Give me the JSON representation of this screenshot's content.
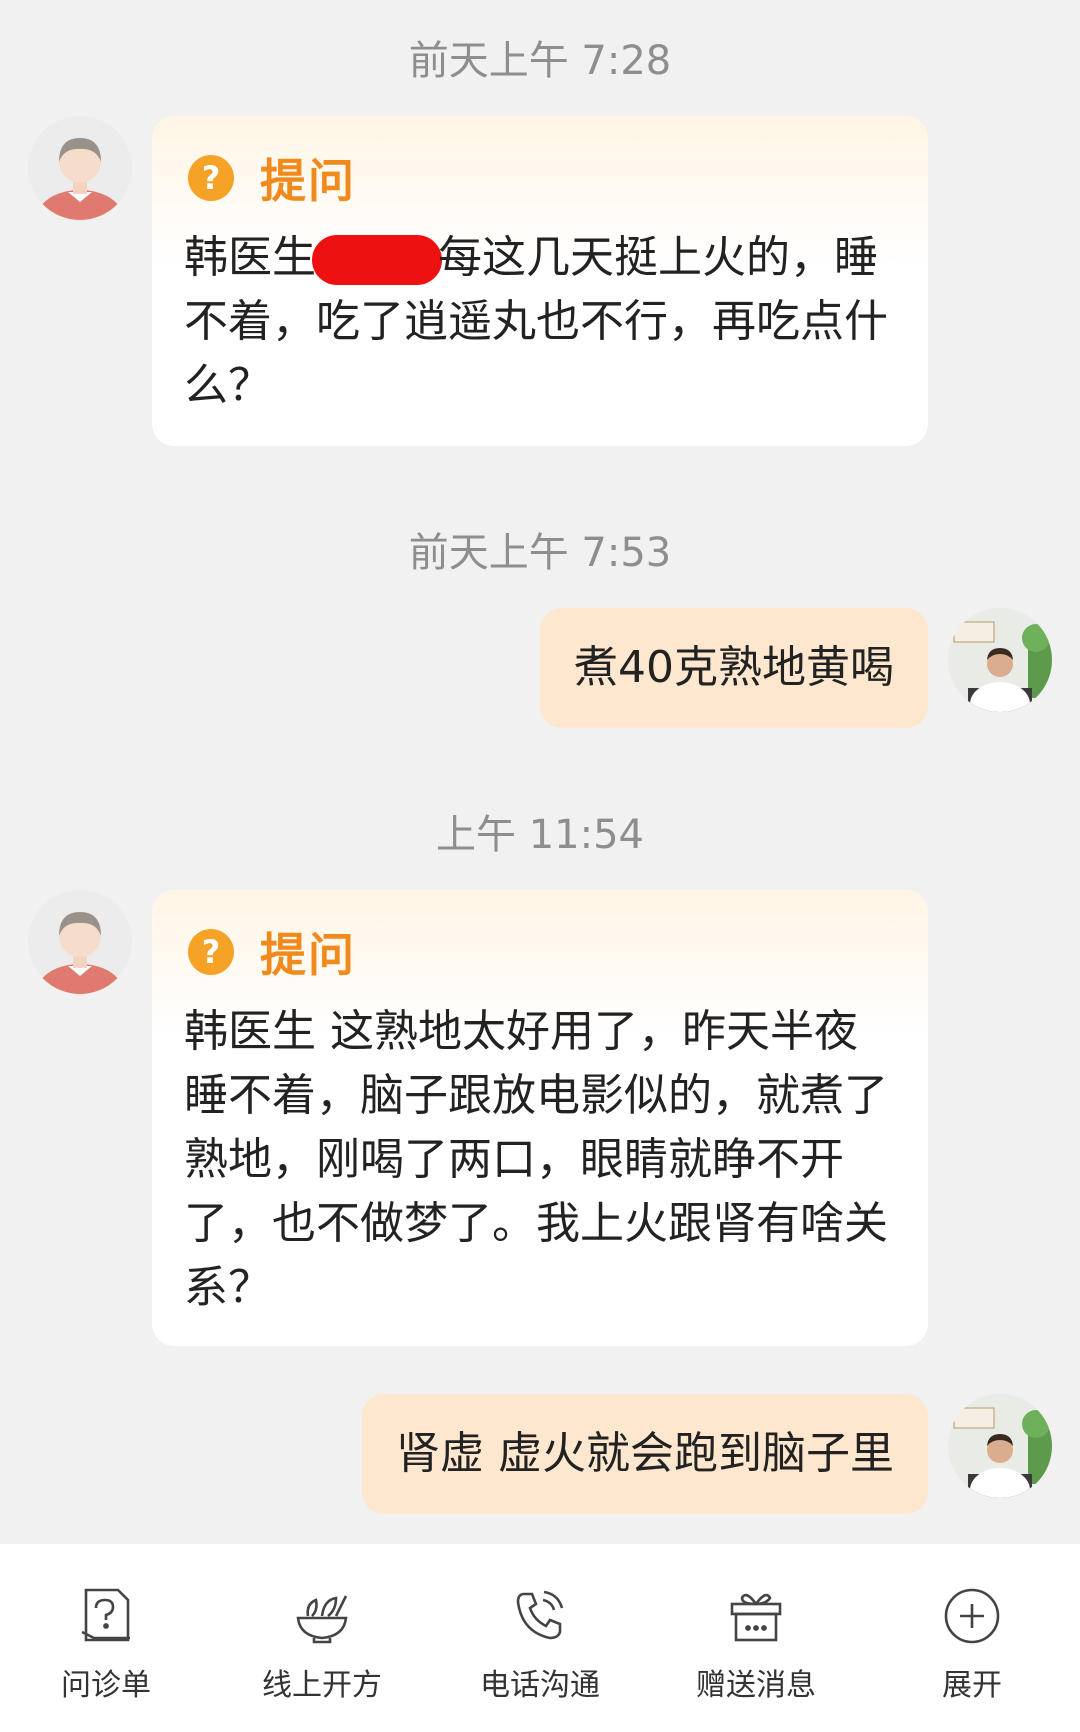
{
  "messages": [
    {
      "time": "前天上午 7:28",
      "type": "question",
      "title": "提问",
      "text_before": "韩医生",
      "text_after": "每这几天挺上火的，睡不着，吃了逍遥丸也不行，再吃点什么？"
    },
    {
      "time": "前天上午 7:53",
      "type": "answer",
      "text": "煮40克熟地黄喝"
    },
    {
      "time": "上午 11:54",
      "type": "question",
      "title": "提问",
      "text": "韩医生 这熟地太好用了，昨天半夜睡不着，脑子跟放电影似的，就煮了熟地，刚喝了两口，眼睛就睁不开了，也不做梦了。我上火跟肾有啥关系？"
    },
    {
      "type": "answer",
      "text": "肾虚 虚火就会跑到脑子里"
    }
  ],
  "toolbar": {
    "items": [
      {
        "label": "问诊单",
        "icon": "form-icon"
      },
      {
        "label": "线上开方",
        "icon": "herb-bowl-icon"
      },
      {
        "label": "电话沟通",
        "icon": "phone-icon"
      },
      {
        "label": "赠送消息",
        "icon": "gift-icon"
      },
      {
        "label": "展开",
        "icon": "plus-circle-icon"
      }
    ]
  },
  "colors": {
    "background": "#f1f1f1",
    "accent": "#f08a1c",
    "answer_bubble": "#fde8cf",
    "redaction": "#ee1111"
  }
}
